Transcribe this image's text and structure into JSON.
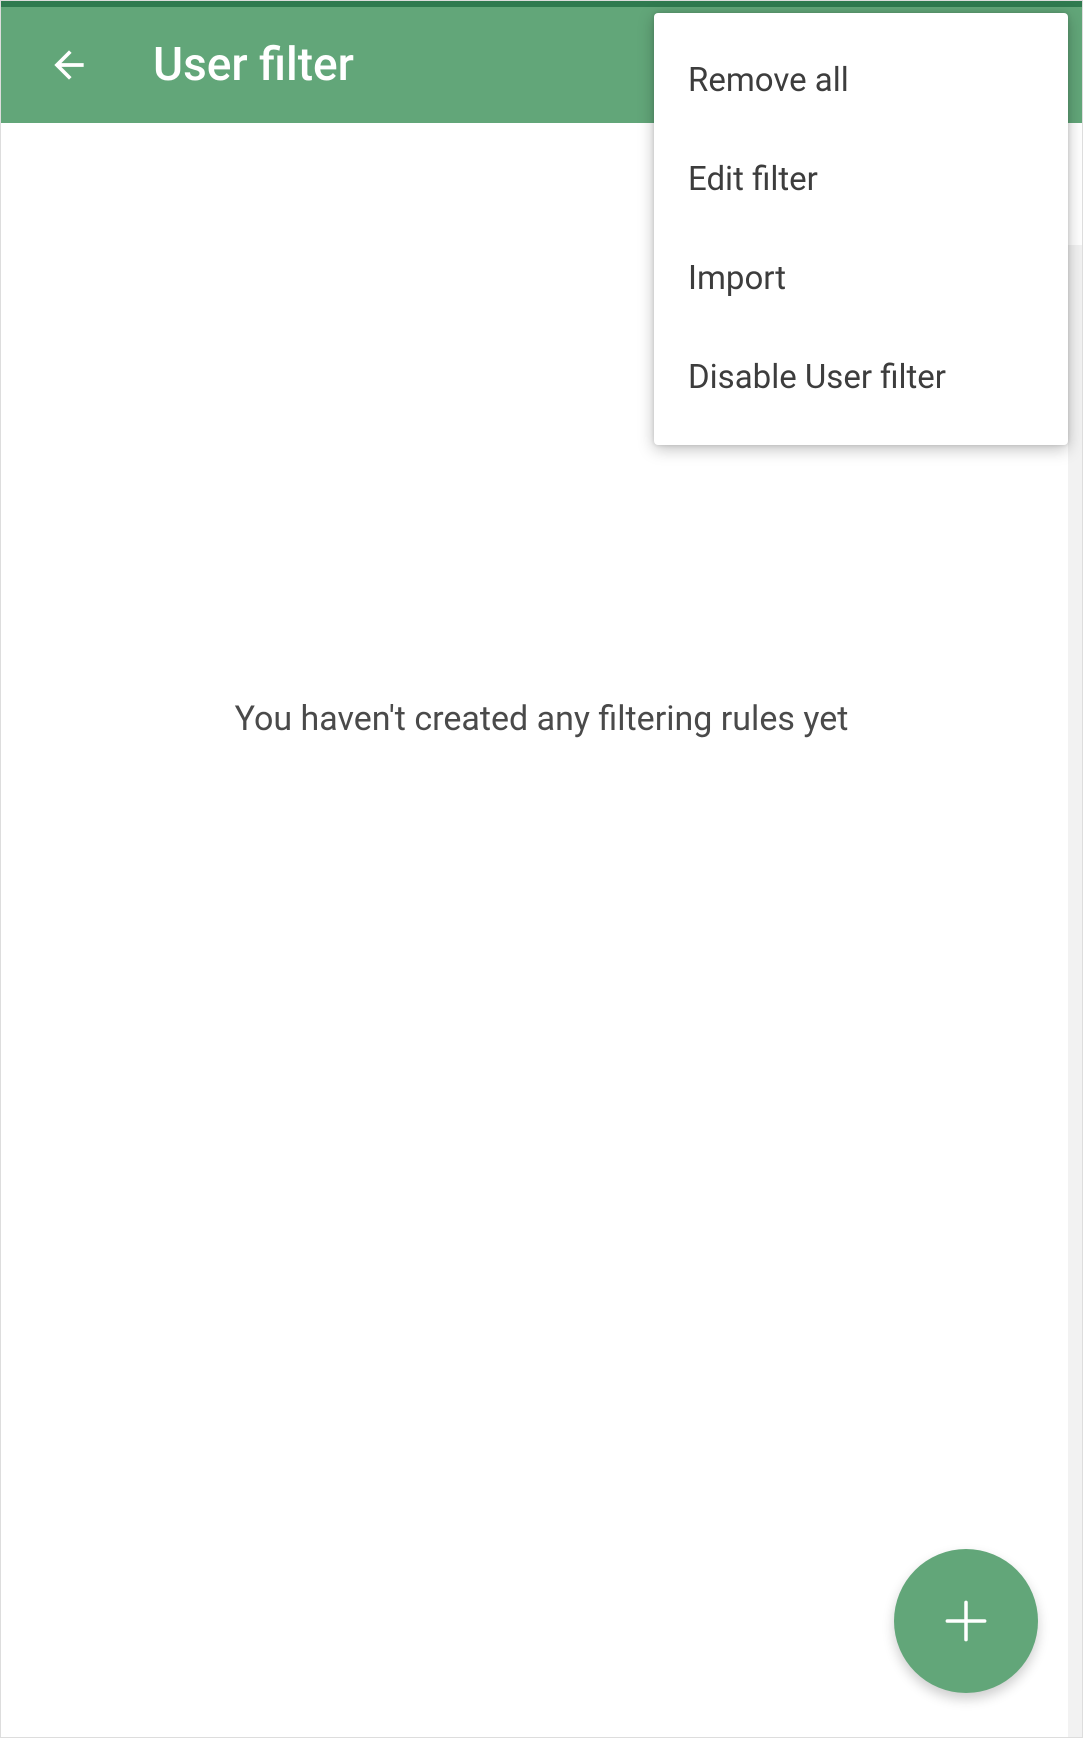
{
  "header": {
    "title": "User filter"
  },
  "menu": {
    "items": [
      {
        "label": "Remove all"
      },
      {
        "label": "Edit filter"
      },
      {
        "label": "Import"
      },
      {
        "label": "Disable User filter"
      }
    ]
  },
  "content": {
    "empty_message": "You haven't created any filtering rules yet"
  },
  "colors": {
    "accent": "#62a679",
    "accent_dark": "#2f7a4f"
  }
}
